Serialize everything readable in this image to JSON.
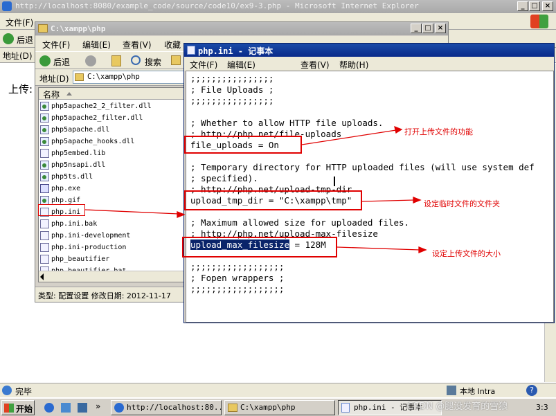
{
  "ie": {
    "title": "http://localhost:8080/example_code/source/code10/ex9-3.php - Microsoft Internet Explorer",
    "menu_file": "文件(F)",
    "back": "后退",
    "address_label": "地址(D)",
    "upload_label": "上传:",
    "status_done": "完毕",
    "zone": "本地 Intra"
  },
  "explorer": {
    "title": "C:\\xampp\\php",
    "menu": [
      "文件(F)",
      "编辑(E)",
      "查看(V)",
      "收藏"
    ],
    "back": "后退",
    "search": "搜索",
    "address_label": "地址(D)",
    "address_value": "C:\\xampp\\php",
    "column_name": "名称",
    "files": [
      {
        "name": "php5apache2_2_filter.dll",
        "type": "dll"
      },
      {
        "name": "php5apache2_filter.dll",
        "type": "dll"
      },
      {
        "name": "php5apache.dll",
        "type": "dll"
      },
      {
        "name": "php5apache_hooks.dll",
        "type": "dll"
      },
      {
        "name": "php5embed.lib",
        "type": "doc"
      },
      {
        "name": "php5nsapi.dll",
        "type": "dll"
      },
      {
        "name": "php5ts.dll",
        "type": "dll"
      },
      {
        "name": "php.exe",
        "type": "php"
      },
      {
        "name": "php.gif",
        "type": "dll"
      },
      {
        "name": "php.ini",
        "type": "doc"
      },
      {
        "name": "php.ini.bak",
        "type": "doc"
      },
      {
        "name": "php.ini-development",
        "type": "doc"
      },
      {
        "name": "php.ini-production",
        "type": "doc"
      },
      {
        "name": "php_beautifier",
        "type": "doc"
      },
      {
        "name": "php_beautifier.bat",
        "type": "doc"
      }
    ],
    "status": "类型: 配置设置 修改日期: 2012-11-17"
  },
  "notepad": {
    "title": "php.ini - 记事本",
    "menu": [
      "文件(F)",
      "编辑(E)",
      "查看(V)",
      "帮助(H)"
    ],
    "lines": [
      ";;;;;;;;;;;;;;;;",
      "; File Uploads ;",
      ";;;;;;;;;;;;;;;;",
      "",
      "; Whether to allow HTTP file uploads.",
      "; http://php.net/file-uploads",
      "file_uploads = On",
      "",
      "; Temporary directory for HTTP uploaded files (will use system def",
      "; specified).",
      "; http://php.net/upload-tmp-dir",
      "upload_tmp_dir = \"C:\\xampp\\tmp\"",
      "",
      "; Maximum allowed size for uploaded files.",
      "; http://php.net/upload-max-filesize",
      "upload_max_filesize = 128M",
      "",
      ";;;;;;;;;;;;;;;;;;",
      "; Fopen wrappers ;",
      ";;;;;;;;;;;;;;;;;;"
    ],
    "selected_text": "upload_max_filesize"
  },
  "annotations": {
    "file_uploads": "打开上传文件的功能",
    "upload_tmp_dir": "设定临时文件的文件夹",
    "upload_max_filesize": "设定上传文件的大小"
  },
  "taskbar": {
    "start": "开始",
    "buttons": [
      "http://localhost:80...",
      "C:\\xampp\\php",
      "php.ini - 记事本"
    ],
    "clock": "3:3",
    "watermark": "CSDN @腿没发育的雪狼"
  },
  "colors": {
    "annotation_red": "#e00000",
    "selection_blue": "#0a246a",
    "active_title": "#0a2a8a"
  }
}
